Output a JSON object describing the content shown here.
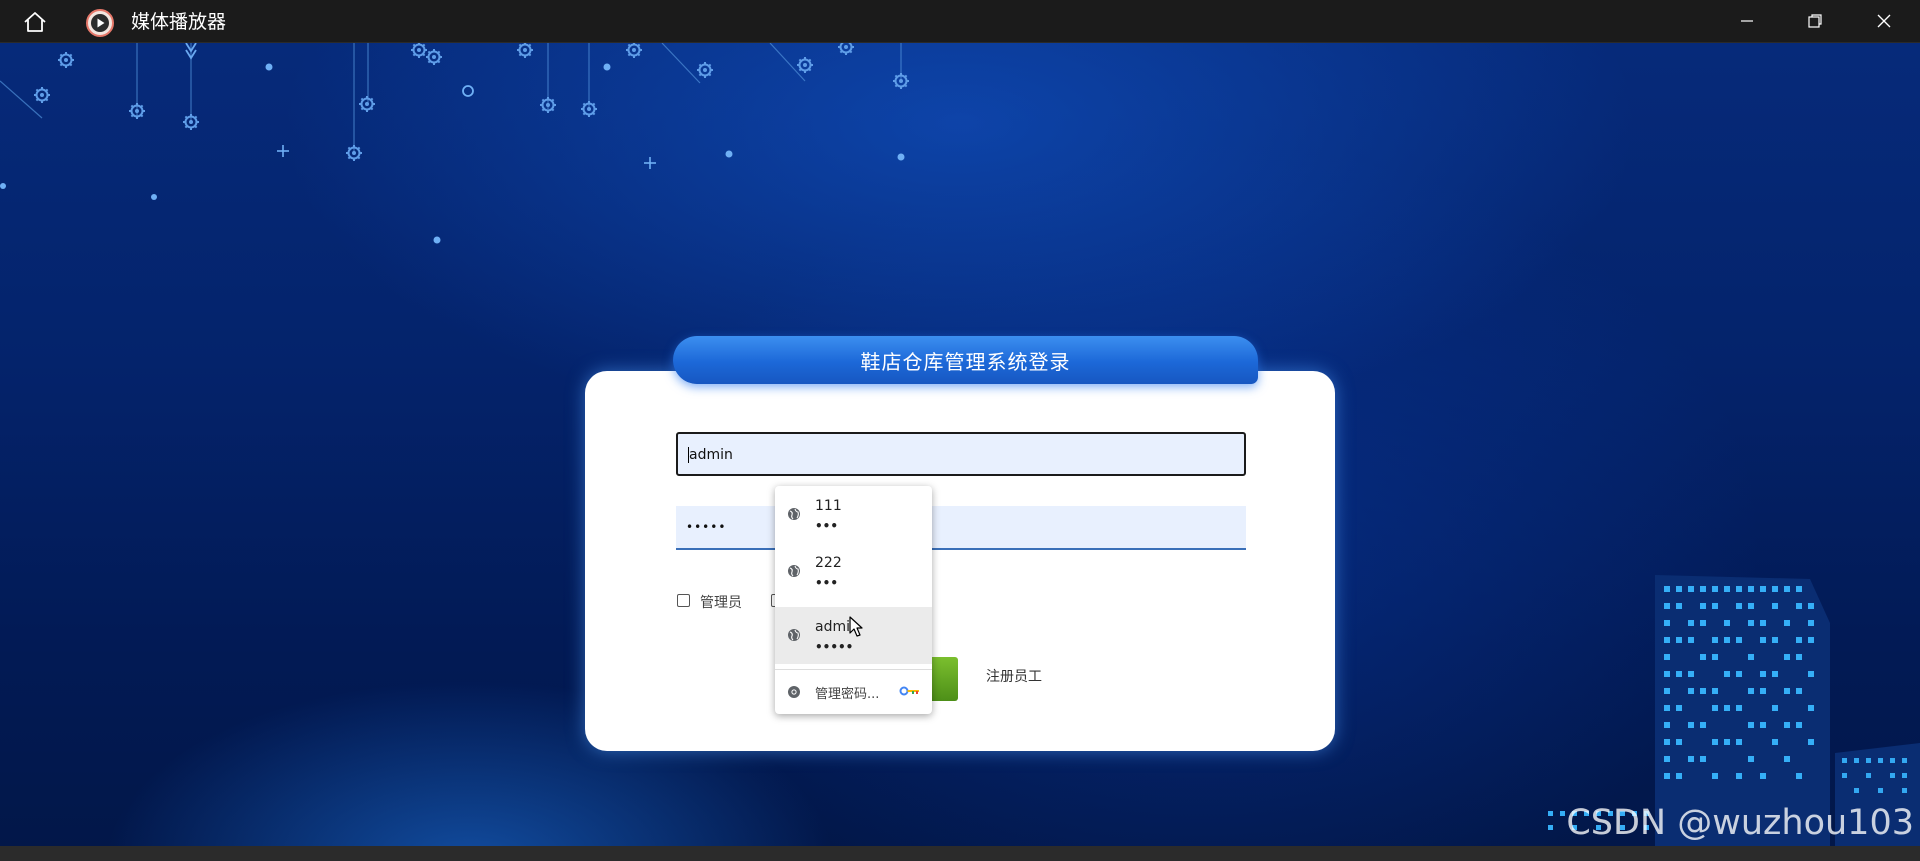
{
  "titlebar": {
    "title": "媒体播放器",
    "home_icon": "home-icon",
    "app_icon": "media-player-icon",
    "minimize_icon": "minimize-icon",
    "maximize_icon": "restore-icon",
    "close_icon": "close-icon",
    "background_color": "#1b1b1b"
  },
  "login": {
    "title": "鞋店仓库管理系统登录",
    "username_value": "admin",
    "password_value": "•••••",
    "checkbox_admin_label": "管理员",
    "register_label": "注册员工",
    "tab_color": "#1c68d8",
    "login_button_color": "#5fa320"
  },
  "autofill": {
    "items": [
      {
        "user": "111",
        "pass": "•••",
        "icon": "globe-icon"
      },
      {
        "user": "222",
        "pass": "•••",
        "icon": "globe-icon"
      },
      {
        "user": "admin",
        "pass": "•••••",
        "icon": "globe-icon"
      }
    ],
    "manage_label": "管理密码...",
    "manage_icon": "chrome-icon",
    "key_icon": "key-icon"
  },
  "watermark": "CSDN @wuzhou103"
}
